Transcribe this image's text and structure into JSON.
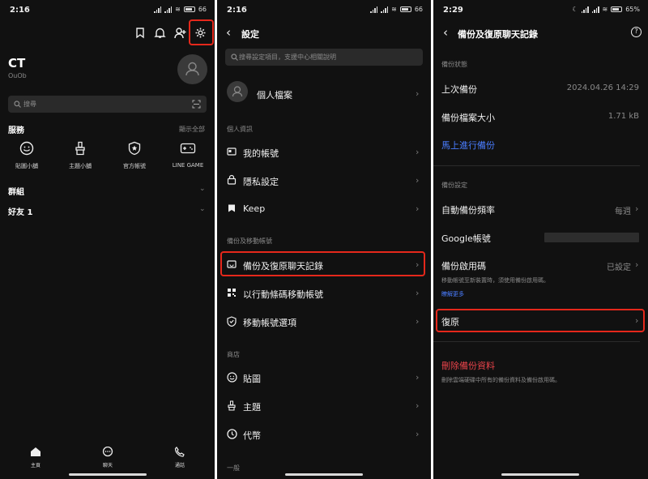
{
  "status": {
    "p1_time": "2:16",
    "p2_time": "2:16",
    "p3_time": "2:29",
    "p1_battery": "66",
    "p2_battery": "66",
    "p3_battery": "65%"
  },
  "home": {
    "user_name": "CT",
    "user_id": "OuOb",
    "search_placeholder": "搜尋",
    "services_title": "服務",
    "show_all": "顯示全部",
    "services": [
      {
        "label": "貼圖小舖",
        "icon": "smile-icon"
      },
      {
        "label": "主題小舖",
        "icon": "brush-icon"
      },
      {
        "label": "官方帳號",
        "icon": "shield-star-icon"
      },
      {
        "label": "LINE GAME",
        "icon": "gamepad-icon"
      }
    ],
    "groups_label": "群組",
    "friends_label": "好友 1",
    "tabs": [
      {
        "label": "主頁",
        "icon": "home-icon"
      },
      {
        "label": "聊天",
        "icon": "chat-icon"
      },
      {
        "label": "通話",
        "icon": "phone-icon"
      }
    ]
  },
  "settings": {
    "title": "設定",
    "search_placeholder": "搜尋設定項目，支援中心相關說明",
    "profile_label": "個人檔案",
    "section_personal": "個人資訊",
    "my_account": "我的帳號",
    "privacy": "隱私設定",
    "keep": "Keep",
    "section_backup": "備份及移動帳號",
    "backup_restore": "備份及復原聊天記錄",
    "qr_transfer": "以行動條碼移動帳號",
    "transfer_options": "移動帳號選項",
    "section_store": "商店",
    "stickers": "貼圖",
    "themes": "主題",
    "coins": "代幣",
    "section_general": "一般"
  },
  "backup": {
    "title": "備份及復原聊天記錄",
    "section_status": "備份狀態",
    "last_backup_label": "上次備份",
    "last_backup_value": "2024.04.26 14:29",
    "size_label": "備份檔案大小",
    "size_value": "1.71 kB",
    "backup_now": "馬上進行備份",
    "section_settings": "備份設定",
    "auto_freq_label": "自動備份頻率",
    "auto_freq_value": "每週",
    "google_label": "Google帳號",
    "pin_label": "備份啟用碼",
    "pin_value": "已設定",
    "pin_desc": "移動帳號至新裝置時，須使用備份啟用碼。",
    "learn_more": "瞭解更多",
    "restore": "復原",
    "delete": "刪除備份資料",
    "delete_desc": "刪除雲端硬碟中所有的備份資料及備份啟用碼。"
  },
  "colors": {
    "accent_red": "#e5281b",
    "link_blue": "#4a7dff",
    "danger_red": "#e8434a"
  }
}
